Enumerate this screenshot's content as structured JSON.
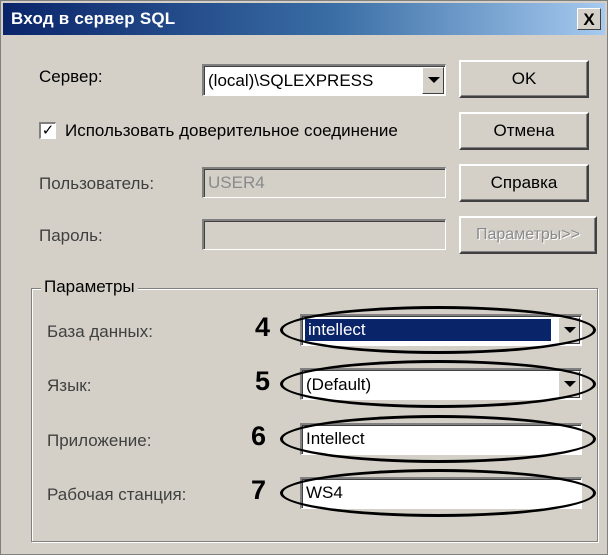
{
  "window": {
    "title": "Вход в сервер SQL",
    "close_glyph": "X"
  },
  "server": {
    "label": "Сервер:",
    "value": "(local)\\SQLEXPRESS"
  },
  "trusted": {
    "label": "Использовать доверительное соединение",
    "checked": true,
    "mark": "✓"
  },
  "user": {
    "label": "Пользователь:",
    "value": "USER4"
  },
  "password": {
    "label": "Пароль:",
    "value": ""
  },
  "buttons": {
    "ok": "OK",
    "cancel": "Отмена",
    "help": "Справка",
    "params": "Параметры>>"
  },
  "params": {
    "legend": "Параметры",
    "database": {
      "label": "База данных:",
      "value": "intellect",
      "marker": "4"
    },
    "language": {
      "label": "Язык:",
      "value": "(Default)",
      "marker": "5"
    },
    "application": {
      "label": "Приложение:",
      "value": "Intellect",
      "marker": "6"
    },
    "workstation": {
      "label": "Рабочая станция:",
      "value": "WS4",
      "marker": "7"
    }
  },
  "colors": {
    "titlebar": "#0a246a",
    "dialog_bg": "#d4d0c8",
    "selection": "#0a246a"
  },
  "icons": {
    "dropdown": "chevron-down-icon",
    "close": "close-icon",
    "check": "checkmark-icon"
  }
}
